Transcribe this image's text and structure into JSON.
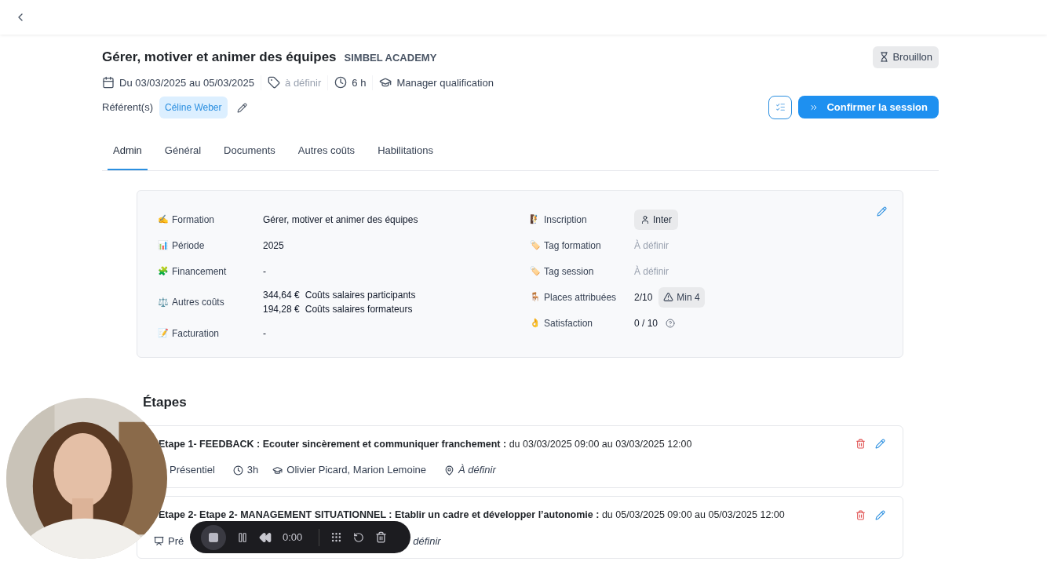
{
  "header": {
    "title": "Gérer, motiver et animer des équipes",
    "organization": "SIMBEL ACADEMY",
    "status": "Brouillon"
  },
  "meta": [
    {
      "kind": "calendar",
      "text": "Du 03/03/2025 au 05/03/2025",
      "muted": false
    },
    {
      "kind": "tag",
      "text": "à définir",
      "muted": true
    },
    {
      "kind": "clock",
      "text": "6 h",
      "muted": false
    },
    {
      "kind": "cap",
      "text": "Manager qualification",
      "muted": false
    }
  ],
  "referents": {
    "label": "Référent(s)",
    "names": [
      "Céline Weber"
    ]
  },
  "confirm_button": "Confirmer la session",
  "tabs": [
    {
      "label": "Admin",
      "selected": true
    },
    {
      "label": "Général",
      "selected": false
    },
    {
      "label": "Documents",
      "selected": false
    },
    {
      "label": "Autres coûts",
      "selected": false
    },
    {
      "label": "Habilitations",
      "selected": false
    }
  ],
  "info_left": [
    {
      "emoji": "✍️",
      "label": "Formation",
      "values": [
        "Gérer, motiver et animer des équipes"
      ]
    },
    {
      "emoji": "📊",
      "label": "Période",
      "values": [
        "2025"
      ]
    },
    {
      "emoji": "🧩",
      "label": "Financement",
      "values": [
        "-"
      ]
    },
    {
      "emoji": "⚖️",
      "label": "Autres coûts",
      "costs": [
        {
          "amount": "344,64 €",
          "label": "Coûts salaires participants"
        },
        {
          "amount": "194,28 €",
          "label": "Coûts salaires formateurs"
        }
      ]
    },
    {
      "emoji": "📝",
      "label": "Facturation",
      "values": [
        "-"
      ]
    }
  ],
  "info_right": [
    {
      "emoji": "🧗",
      "label": "Inscription",
      "kind": "chip",
      "value": "Inter"
    },
    {
      "emoji": "🏷️",
      "label": "Tag formation",
      "kind": "muted",
      "value": "À définir"
    },
    {
      "emoji": "🏷️",
      "label": "Tag session",
      "kind": "muted",
      "value": "À définir"
    },
    {
      "emoji": "🪑",
      "label": "Places attribuées",
      "kind": "places",
      "value": "2/10",
      "badge": "Min 4"
    },
    {
      "emoji": "👌",
      "label": "Satisfaction",
      "kind": "help",
      "value": "0 / 10"
    }
  ],
  "steps_title": "Étapes",
  "steps": [
    {
      "title": "Etape 1- FEEDBACK : Ecouter sincèrement et communiquer franchement :",
      "dates": "du 03/03/2025 09:00 au 03/03/2025 12:00",
      "mode": "Présentiel",
      "mode_icon": false,
      "duration": "3h",
      "trainers": "Olivier Picard, Marion Lemoine",
      "location": "À définir"
    },
    {
      "title": "Etape 2- Etape 2- MANAGEMENT SITUATIONNEL : Etablir un cadre et développer l’autonomie :",
      "dates": "du 05/03/2025 09:00 au 05/03/2025 12:00",
      "mode": "Pré",
      "mode_icon": true,
      "location": "définir"
    }
  ],
  "recorder": {
    "time": "0:00"
  }
}
